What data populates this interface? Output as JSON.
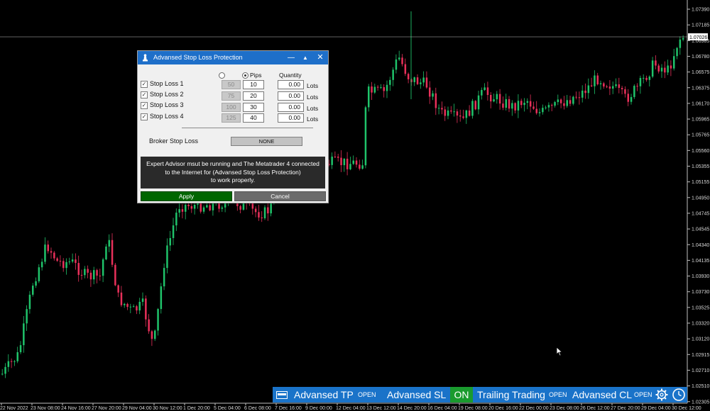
{
  "chart": {
    "price_labels": [
      "1.07390",
      "1.07185",
      "1.06985",
      "1.06780",
      "1.06575",
      "1.06375",
      "1.06170",
      "1.05965",
      "1.05765",
      "1.05560",
      "1.05355",
      "1.05155",
      "1.04950",
      "1.04745",
      "1.04545",
      "1.04340",
      "1.04135",
      "1.03930",
      "1.03730",
      "1.03525",
      "1.03320",
      "1.03120",
      "1.02915",
      "1.02710",
      "1.02510",
      "1.02305"
    ],
    "current_price": "1.07026",
    "date_labels": [
      "22 Nov 2022",
      "23 Nov 08:00",
      "24 Nov 16:00",
      "27 Nov 20:00",
      "29 Nov 04:00",
      "30 Nov 12:00",
      "1 Dec 20:00",
      "5 Dec 04:00",
      "6 Dec 08:00",
      "7 Dec 16:00",
      "9 Dec 00:00",
      "12 Dec 04:00",
      "13 Dec 12:00",
      "14 Dec 20:00",
      "16 Dec 04:00",
      "19 Dec 08:00",
      "20 Dec 16:00",
      "22 Dec 00:00",
      "23 Dec 08:00",
      "26 Dec 12:00",
      "27 Dec 20:00",
      "29 Dec 04:00",
      "30 Dec 12:00"
    ],
    "colors": {
      "bull": "#1fc36a",
      "bear": "#e8305a",
      "text": "#d8d8d8",
      "grid_line": "#555555"
    }
  },
  "dialog": {
    "title": "Advansed Stop Loss Protection",
    "buttons": {
      "minimize": "—",
      "maximize": "▲",
      "close": "✕"
    },
    "headers": {
      "pips": "Pips",
      "quantity": "Quantity"
    },
    "rows": [
      {
        "label": "Stop Loss 1",
        "checked": "✓",
        "preset": "50",
        "pips": "10",
        "quantity": "0.00",
        "unit": "Lots"
      },
      {
        "label": "Stop Loss 2",
        "checked": "✓",
        "preset": "75",
        "pips": "20",
        "quantity": "0.00",
        "unit": "Lots"
      },
      {
        "label": "Stop Loss 3",
        "checked": "✓",
        "preset": "100",
        "pips": "30",
        "quantity": "0.00",
        "unit": "Lots"
      },
      {
        "label": "Stop Loss 4",
        "checked": "✓",
        "preset": "125",
        "pips": "40",
        "quantity": "0.00",
        "unit": "Lots"
      }
    ],
    "broker_label": "Broker Stop Loss",
    "broker_value": "NONE",
    "info_lines": [
      "Expert Advisor msut be running and The Metatrader 4 connected",
      "to the Internet for (Advansed Stop Loss Protection)",
      "to work properly."
    ],
    "apply": "Apply",
    "cancel": "Cancel",
    "colors": {
      "titlebar": "#1e6fc9",
      "apply": "#006600",
      "cancel": "#6b6b6b"
    }
  },
  "panel": {
    "tp_label": "Advansed TP",
    "tp_state": "OPEN",
    "sl_label": "Advansed SL",
    "sl_state": "ON",
    "trailing_label": "Trailing Trading",
    "trailing_state": "OPEN",
    "cl_label": "Advansed CL",
    "cl_state": "OPEN",
    "colors": {
      "panel": "#1a73c9",
      "on": "#1a9b2e"
    }
  }
}
